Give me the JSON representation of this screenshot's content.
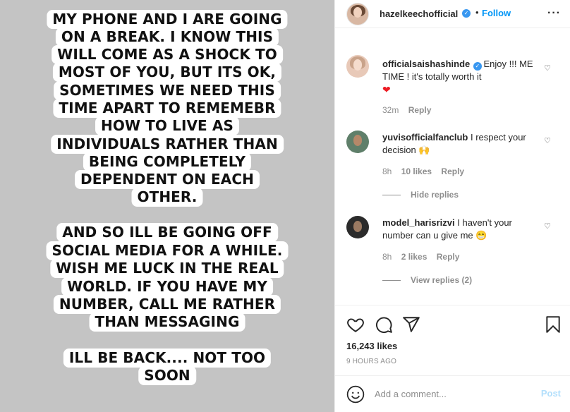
{
  "story": {
    "lines": [
      "MY PHONE AND I ARE GOING",
      "ON A BREAK. I KNOW THIS",
      "WILL COME AS A SHOCK TO",
      "MOST OF YOU, BUT ITS OK,",
      "SOMETIMES WE NEED THIS",
      "TIME APART TO REMEMEBR",
      "HOW TO LIVE AS",
      "INDIVIDUALS RATHER THAN",
      "BEING COMPLETELY",
      "DEPENDENT ON EACH",
      "OTHER.",
      "AND SO ILL BE GOING OFF",
      "SOCIAL MEDIA FOR A WHILE.",
      "WISH ME LUCK IN THE REAL",
      "WORLD. IF YOU HAVE MY",
      "NUMBER, CALL ME RATHER",
      "THAN MESSAGING",
      "ILL BE BACK.... NOT TOO",
      "SOON"
    ]
  },
  "header": {
    "username": "hazelkeechofficial",
    "separator": "•",
    "follow_label": "Follow",
    "more_icon": "more-dots-icon"
  },
  "comments": [
    {
      "username": "officialsaishashinde",
      "text": "Enjoy !!! ME TIME ! it's totally worth it",
      "time": "32m",
      "reply": "Reply"
    },
    {
      "username": "yuvisofficialfanclub",
      "text": "I respect your decision",
      "time": "8h",
      "likes": "10 likes",
      "reply": "Reply",
      "hide_replies": "Hide replies"
    },
    {
      "username": "model_harisrizvi",
      "text": "I haven't your number can u give me",
      "time": "8h",
      "likes": "2 likes",
      "reply": "Reply",
      "view_replies": "View replies (2)"
    }
  ],
  "actions": {
    "likes": "16,243 likes",
    "posted": "9 HOURS AGO"
  },
  "add_comment": {
    "placeholder": "Add a comment...",
    "post_label": "Post"
  },
  "colors": {
    "accent": "#0095f6",
    "verified": "#3897f0",
    "heart": "#ed1c24",
    "story_bg": "#c4c4c4"
  }
}
